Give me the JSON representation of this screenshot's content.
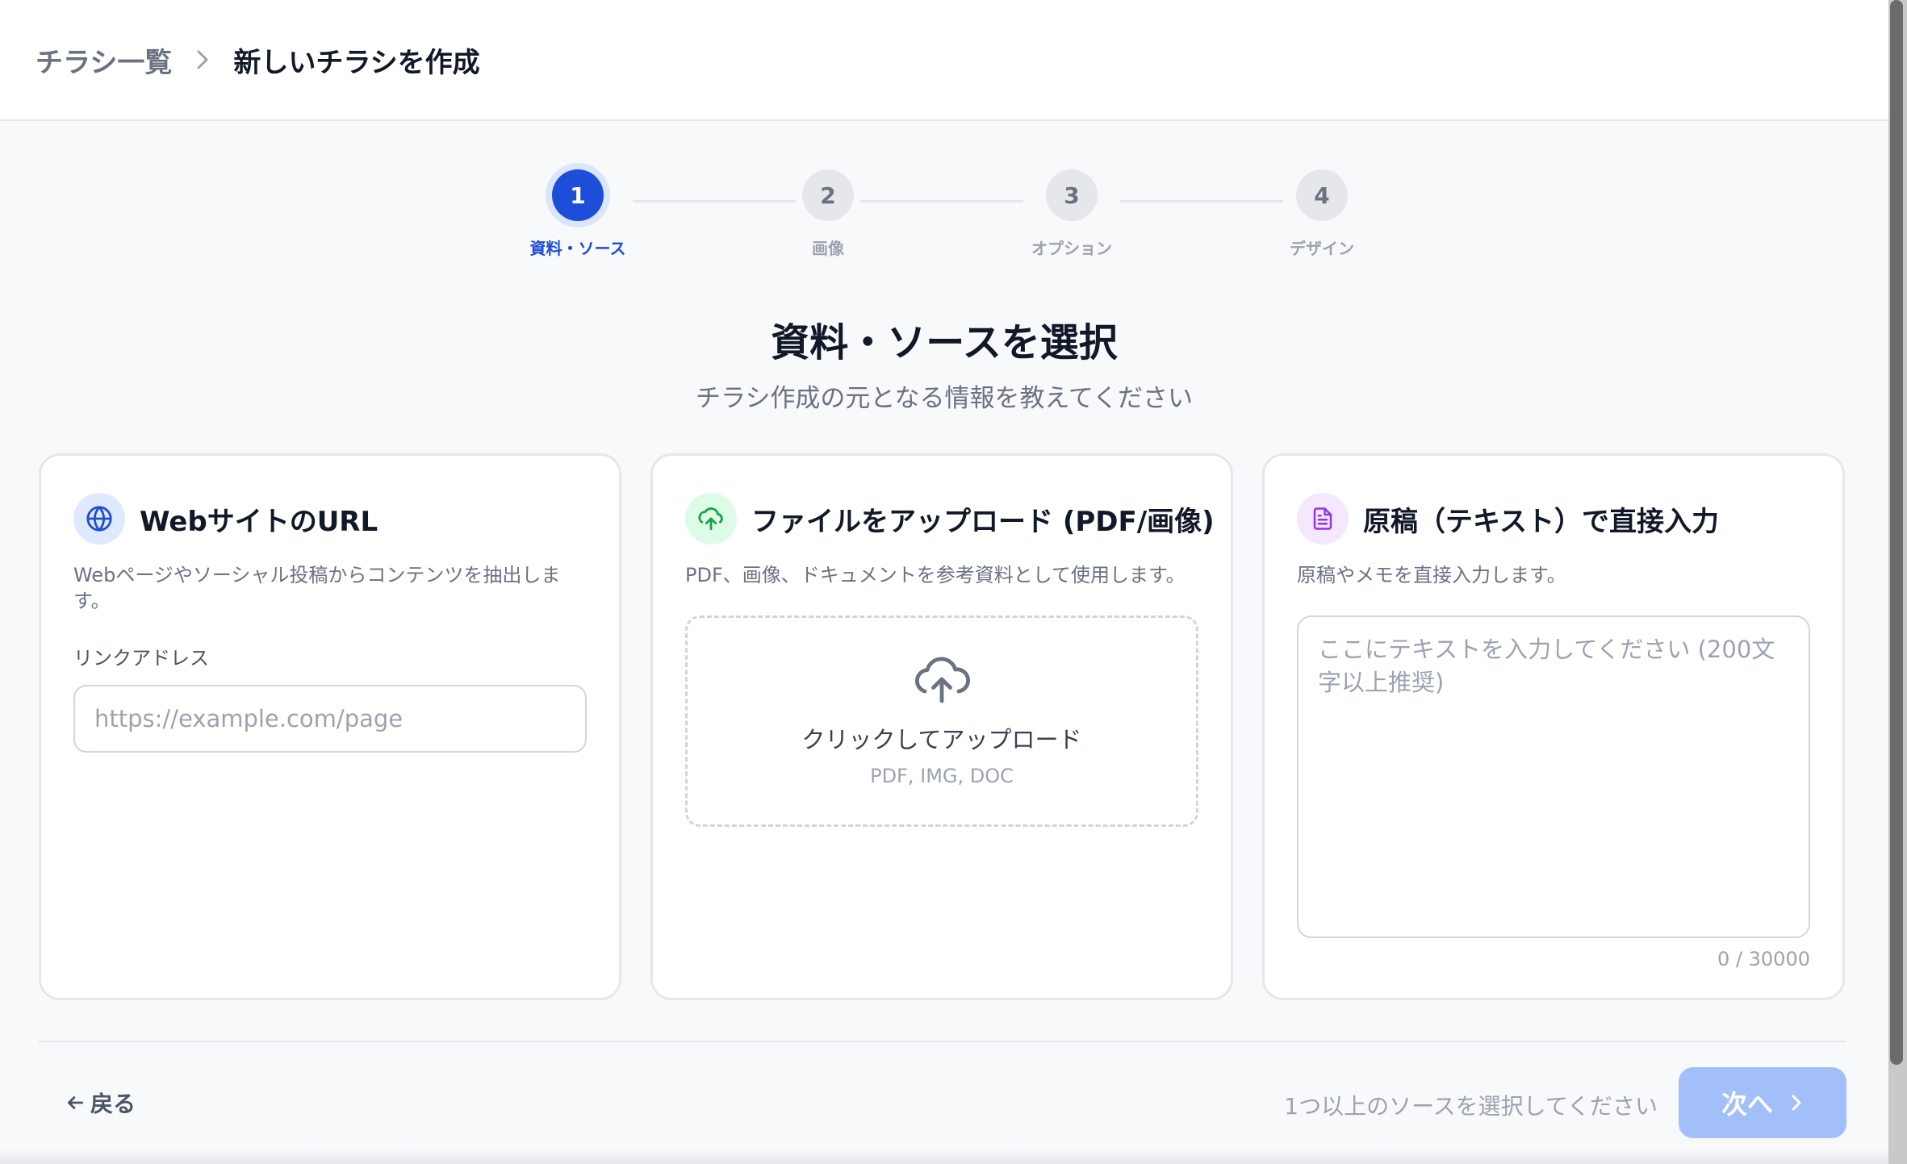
{
  "breadcrumb": {
    "parent": "チラシ一覧",
    "current": "新しいチラシを作成"
  },
  "stepper": {
    "steps": [
      {
        "number": "1",
        "label": "資料・ソース",
        "state": "active"
      },
      {
        "number": "2",
        "label": "画像",
        "state": "inactive"
      },
      {
        "number": "3",
        "label": "オプション",
        "state": "inactive"
      },
      {
        "number": "4",
        "label": "デザイン",
        "state": "inactive"
      }
    ]
  },
  "page": {
    "title": "資料・ソースを選択",
    "subtitle": "チラシ作成の元となる情報を教えてください"
  },
  "cards": {
    "web": {
      "icon": "globe-icon",
      "icon_color": "#1d4ed8",
      "icon_bg": "#e0eaff",
      "title": "WebサイトのURL",
      "description": "Webページやソーシャル投稿からコンテンツを抽出します。",
      "field_label": "リンクアドレス",
      "placeholder": "https://example.com/page",
      "value": ""
    },
    "upload": {
      "icon": "cloud-upload-icon",
      "icon_color": "#16a34a",
      "icon_bg": "#dcfce7",
      "title": "ファイルをアップロード (PDF/画像)",
      "description": "PDF、画像、ドキュメントを参考資料として使用します。",
      "dropzone_label": "クリックしてアップロード",
      "dropzone_formats": "PDF, IMG, DOC"
    },
    "text": {
      "icon": "document-icon",
      "icon_color": "#9333ea",
      "icon_bg": "#f3e8ff",
      "title": "原稿（テキスト）で直接入力",
      "description": "原稿やメモを直接入力します。",
      "placeholder": "ここにテキストを入力してください (200文字以上推奨)",
      "value": "",
      "counter": "0 / 30000"
    }
  },
  "footer": {
    "back_label": "戻る",
    "hint": "1つ以上のソースを選択してください",
    "next_label": "次へ",
    "next_enabled": false,
    "accent": "#1d4ed8"
  }
}
